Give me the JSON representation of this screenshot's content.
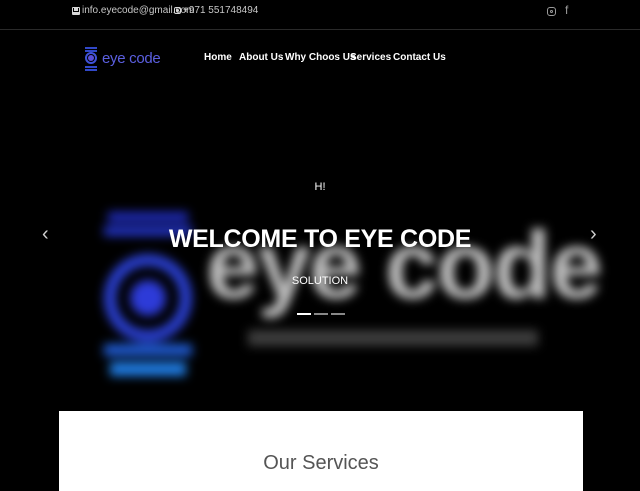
{
  "topbar": {
    "email": "info.eyecode@gmail.com",
    "phone": "+971 551748494",
    "social": [
      "instagram-icon",
      "facebook-icon"
    ],
    "facebook_glyph": "f"
  },
  "header": {
    "logo_text": "eye code",
    "nav": [
      "Home",
      "About Us",
      "Why Choos Us",
      "Services",
      "Contact Us"
    ]
  },
  "hero": {
    "greeting": "H!",
    "title": "WELCOME TO EYE CODE",
    "subtitle": "SOLUTION",
    "background_logo_text": "eye code",
    "prev_glyph": "‹",
    "next_glyph": "›",
    "slide_count": 3,
    "active_slide": 1
  },
  "services": {
    "title": "Our Services"
  },
  "colors": {
    "background": "#000000",
    "brand_blue": "#3f52d8",
    "panel": "#ffffff"
  }
}
